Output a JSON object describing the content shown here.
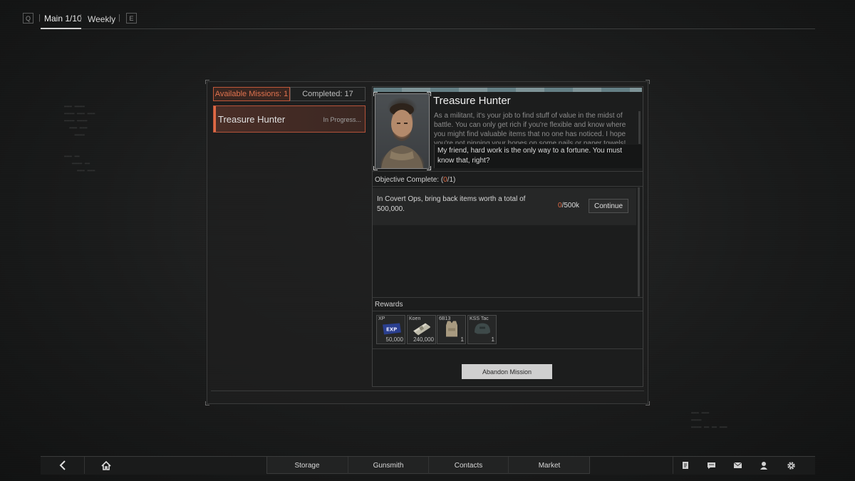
{
  "top_nav": {
    "left_key": "Q",
    "right_key": "E",
    "tabs": [
      {
        "label": "Main 1/10",
        "active": true
      },
      {
        "label": "Weekly",
        "active": false
      }
    ]
  },
  "missions_panel": {
    "available_tab": "Available Missions: 1",
    "completed_tab": "Completed: 17",
    "items": [
      {
        "name": "Treasure Hunter",
        "status": "In Progress..."
      }
    ]
  },
  "detail": {
    "title": "Treasure Hunter",
    "description": "As a militant, it's your job to find stuff of value in the midst of battle. You can only get rich if you're flexible and know where you might find valuable items that no one has noticed. I hope you're not pinning your hopes on some nails or paper towels!",
    "quote": "My friend, hard work is the only way to a fortune. You must know that, right?",
    "objective_header_prefix": "Objective Complete: (",
    "objective_header_done": "0",
    "objective_header_suffix": "/1)",
    "objectives": [
      {
        "text": "In Covert Ops, bring back items worth a total of 500,000.",
        "progress_current": "0",
        "progress_total": "/500k",
        "button": "Continue"
      }
    ],
    "rewards_label": "Rewards",
    "rewards": [
      {
        "label": "XP",
        "qty": "50,000",
        "icon": "exp-icon"
      },
      {
        "label": "Koen",
        "qty": "240,000",
        "icon": "cash-icon"
      },
      {
        "label": "6B13",
        "qty": "1",
        "icon": "vest-icon"
      },
      {
        "label": "KSS Tac",
        "qty": "1",
        "icon": "helmet-icon"
      }
    ],
    "abandon_button": "Abandon Mission"
  },
  "bottom_nav": {
    "items": [
      "Storage",
      "Gunsmith",
      "Contacts",
      "Market"
    ]
  },
  "colors": {
    "accent": "#e06a45",
    "panel": "#1c1d1d"
  }
}
